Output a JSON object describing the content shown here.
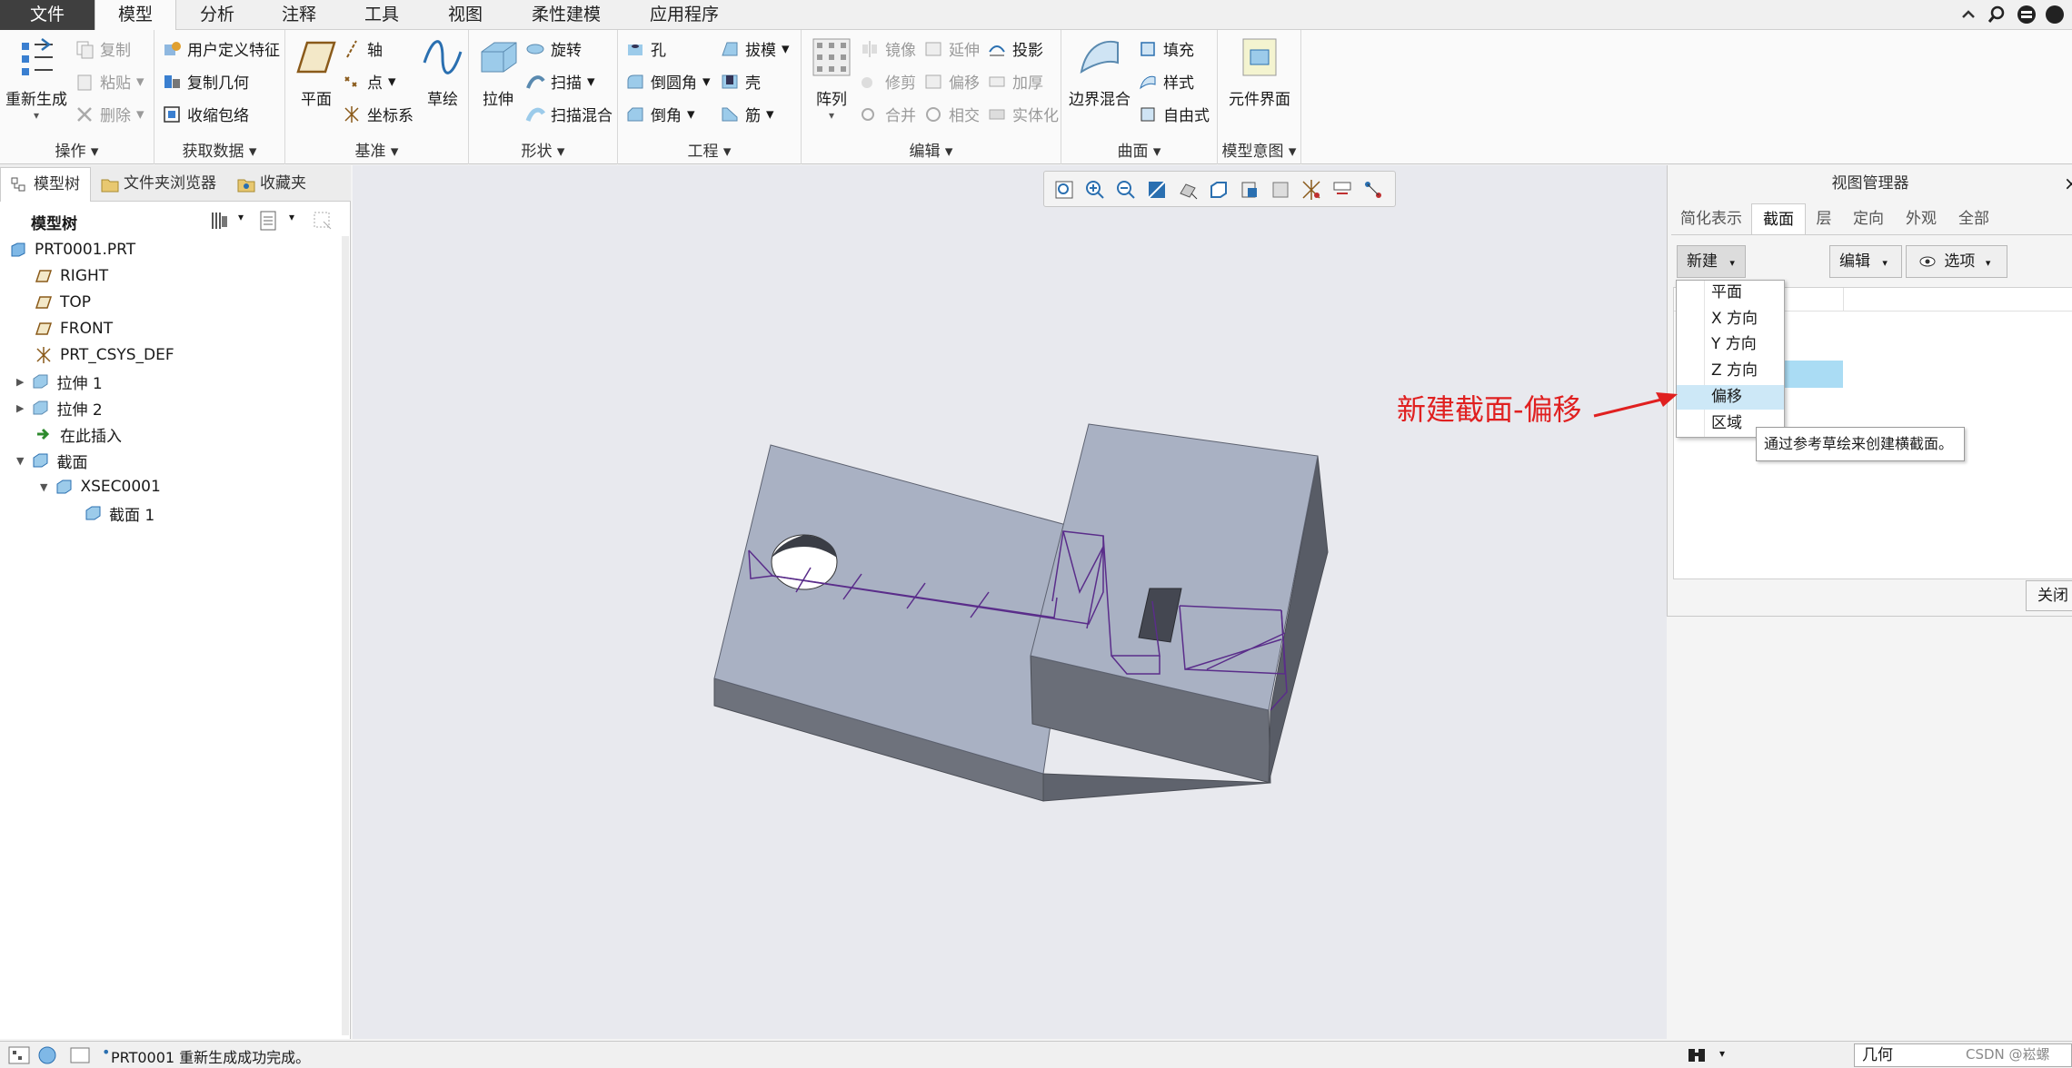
{
  "menubar": {
    "tabs": [
      "文件",
      "模型",
      "分析",
      "注释",
      "工具",
      "视图",
      "柔性建模",
      "应用程序"
    ],
    "active": "模型"
  },
  "ribbon": {
    "operations": {
      "regenerate": "重新生成",
      "copy": "复制",
      "paste": "粘贴",
      "delete": "删除",
      "label": "操作"
    },
    "getdata": {
      "udf": "用户定义特征",
      "copygeom": "复制几何",
      "shrinkwrap": "收缩包络",
      "label": "获取数据"
    },
    "datum": {
      "plane": "平面",
      "axis": "轴",
      "point": "点",
      "csys": "坐标系",
      "sketch": "草绘",
      "label": "基准"
    },
    "shapes": {
      "extrude": "拉伸",
      "revolve": "旋转",
      "sweep": "扫描",
      "sweptblend": "扫描混合",
      "label": "形状"
    },
    "engineering": {
      "hole": "孔",
      "round": "倒圆角",
      "chamfer": "倒角",
      "draft": "拔模",
      "shell": "壳",
      "rib": "筋",
      "label": "工程"
    },
    "editing": {
      "pattern": "阵列",
      "mirror": "镜像",
      "trim": "修剪",
      "merge": "合并",
      "extend": "延伸",
      "offset": "偏移",
      "intersect": "相交",
      "project": "投影",
      "thicken": "加厚",
      "solidify": "实体化",
      "label": "编辑"
    },
    "surfaces": {
      "boundary": "边界混合",
      "fill": "填充",
      "style": "样式",
      "freestyle": "自由式",
      "label": "曲面"
    },
    "intent": {
      "compinterface": "元件界面",
      "label": "模型意图"
    }
  },
  "leftpanel": {
    "tabs": [
      "模型树",
      "文件夹浏览器",
      "收藏夹"
    ],
    "tree_title": "模型树",
    "items": [
      "PRT0001.PRT",
      "RIGHT",
      "TOP",
      "FRONT",
      "PRT_CSYS_DEF",
      "拉伸 1",
      "拉伸 2",
      "在此插入",
      "截面",
      "XSEC0001",
      "截面 1"
    ]
  },
  "viewmanager": {
    "title": "视图管理器",
    "tabs": [
      "简化表示",
      "截面",
      "层",
      "定向",
      "外观",
      "全部"
    ],
    "active_tab": "截面",
    "new_btn": "新建",
    "edit_btn": "编辑",
    "options_btn": "选项",
    "close_btn": "关闭",
    "dropdown": [
      "平面",
      "X 方向",
      "Y 方向",
      "Z 方向",
      "偏移",
      "区域"
    ],
    "highlighted": "偏移",
    "tooltip": "通过参考草绘来创建横截面。"
  },
  "annotation": "新建截面-偏移",
  "status": {
    "message": "PRT0001 重新生成成功完成。",
    "filter": "几何",
    "watermark": "CSDN @崧螺"
  },
  "colors": {
    "annotation": "#e02020",
    "highlight": "#cde8f7",
    "model_top": "#a9b1c3",
    "model_front": "#6a6e78",
    "section_line": "#5a2d8a"
  }
}
